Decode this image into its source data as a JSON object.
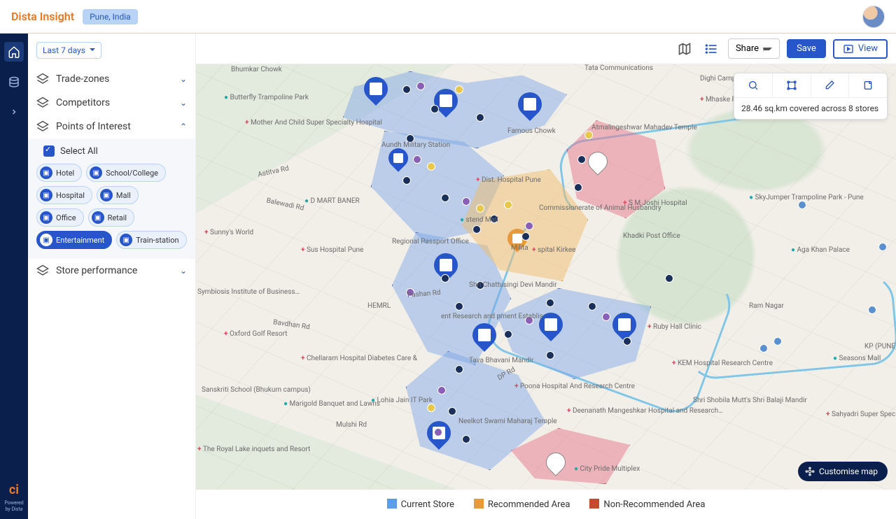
{
  "header": {
    "brand": "Dista Insight",
    "location": "Pune, India"
  },
  "rail": {
    "powered_line1": "Powered",
    "powered_line2": "by Dista"
  },
  "sidebar": {
    "time_range": "Last 7 days",
    "sections": {
      "trade_zones": "Trade-zones",
      "competitors": "Competitors",
      "poi": "Points of Interest",
      "store_perf": "Store performance"
    },
    "select_all": "Select All",
    "chips": [
      {
        "label": "Hotel",
        "selected": false
      },
      {
        "label": "School/College",
        "selected": false
      },
      {
        "label": "Hospital",
        "selected": false
      },
      {
        "label": "Mall",
        "selected": false
      },
      {
        "label": "Office",
        "selected": false
      },
      {
        "label": "Retail",
        "selected": false
      },
      {
        "label": "Entertainment",
        "selected": true
      },
      {
        "label": "Train-station",
        "selected": false
      }
    ]
  },
  "toolbar": {
    "share": "Share",
    "save": "Save",
    "view": "View"
  },
  "map_tools": {
    "coverage": "28.46 sq.km covered across 8 stores"
  },
  "customise": "Customise map",
  "legend": {
    "current": "Current Store",
    "recommended": "Recommended Area",
    "non_recommended": "Non-Recommended Area"
  },
  "map_labels": {
    "tata": "Tata Communications",
    "dmart": "D MART BANER",
    "sunny": "Sunny's World",
    "sus": "Sus Hospital Pune",
    "symb": "Symbiosis Institute of Business…",
    "oxford": "Oxford Golf Resort",
    "marigold": "Marigold Banquet and Lawns",
    "lohia": "Lohia Jain IT Park",
    "mulshi": "Mulshi Rd",
    "royal": "The Royal Lake inquets and Resort",
    "chellaram": "Chellaram Hospital Diabetes Care &",
    "sankriti": "Sanskriti School (Bhukum campus)",
    "mother": "Mother And Child Super Specialty Hospital",
    "butterfly": "Butterfly Trampoline Park",
    "bhumkar": "Bhumkar Chowk",
    "famous": "Famous Chowk",
    "dist_hosp": "Dist. Hospital Pune",
    "anim": "Commissionerate of Animal Husbandry",
    "smj": "S M Joshi Hospital",
    "khadki": "Khadki Post Office",
    "ruby": "Ruby Hall Clinic",
    "kem": "KEM Hospital Research Centre",
    "poona": "Poona Hospital And Research Centre",
    "deenanath": "Deenanath Mangeshkar Hospital and Research…",
    "city": "City Pride Multiplex",
    "shrishobi": "Shri Shobila Mutt's Shri Balaji Mandir",
    "sahyadri": "Sahyadri Super Speciality Hospital Hadapsar",
    "seasons": "Seasons Mall",
    "aga": "Aga Khan Palace",
    "skyjump": "SkyJumper Trampoline Park - Pune",
    "dighi": "Dighi Camp Post Office",
    "mhaske": "Mhaske Pmc hospital",
    "maling": "Atmalingeshwar Mahadev Temple",
    "kirkee": "spital Kirkee",
    "military": "Milita",
    "chatt": "Shri Chattusingi Devi Mandir",
    "hemrl": "HEMRL",
    "astitva": "Astitva Rd",
    "ram": "Ram Nagar",
    "aundh_mil": "Aundh Military Station",
    "bavdhan": "Bavdhan Rd",
    "pashan": "Pashan Rd",
    "neelkant": "Neelkot Swami Maharaj Temple",
    "tavabhavani": "Tava Bhavani Mandir",
    "balewadi": "Balewadi Rd",
    "westend": "stend Mall",
    "passport": "Regional Passport Office",
    "postresearch": "ent Research and pment Establis",
    "dp": "DP Rd",
    "kp": "KP (PUNE)"
  }
}
